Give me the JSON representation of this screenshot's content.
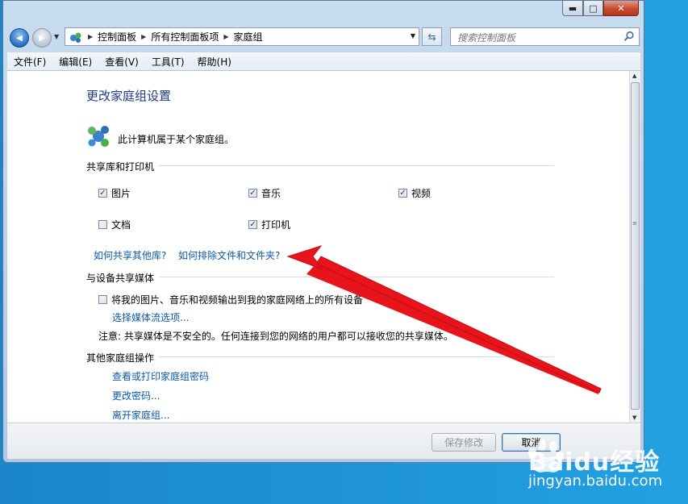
{
  "window": {
    "caption": {
      "minimize_glyph": "▬",
      "maximize_glyph": "□",
      "close_glyph": "✕"
    }
  },
  "navbar": {
    "back_glyph": "◀",
    "forward_glyph": "▶",
    "breadcrumbs": [
      "控制面板",
      "所有控制面板项",
      "家庭组"
    ],
    "search_placeholder": "搜索控制面板"
  },
  "menu": [
    "文件(F)",
    "编辑(E)",
    "查看(V)",
    "工具(T)",
    "帮助(H)"
  ],
  "page": {
    "title": "更改家庭组设置",
    "belongs_text": "此计算机属于某个家庭组。",
    "share_section_label": "共享库和打印机",
    "share_items": [
      {
        "label": "图片",
        "checked": true
      },
      {
        "label": "音乐",
        "checked": true
      },
      {
        "label": "视频",
        "checked": true
      },
      {
        "label": "文档",
        "checked": false
      },
      {
        "label": "打印机",
        "checked": true
      }
    ],
    "link_share_other": "如何共享其他库?",
    "link_exclude": "如何排除文件和文件夹?",
    "media_section_label": "与设备共享媒体",
    "media_checkbox_label": "将我的图片、音乐和视频输出到我的家庭网络上的所有设备",
    "media_checked": false,
    "link_media_options": "选择媒体流选项...",
    "note": "注意: 共享媒体是不安全的。任何连接到您的网络的用户都可以接收您的共享媒体。",
    "other_section_label": "其他家庭组操作",
    "other_links": [
      "查看或打印家庭组密码",
      "更改密码...",
      "离开家庭组..."
    ]
  },
  "footer": {
    "save_label": "保存修改",
    "save_enabled": false,
    "cancel_label": "取消"
  },
  "watermark": {
    "brand": "Baidu经验",
    "url": "jingyan.baidu.com"
  },
  "colors": {
    "link": "#0b5aa8",
    "title": "#1e3a8a",
    "arrow": "#e8141b",
    "desktop": "#1c8fd0"
  }
}
